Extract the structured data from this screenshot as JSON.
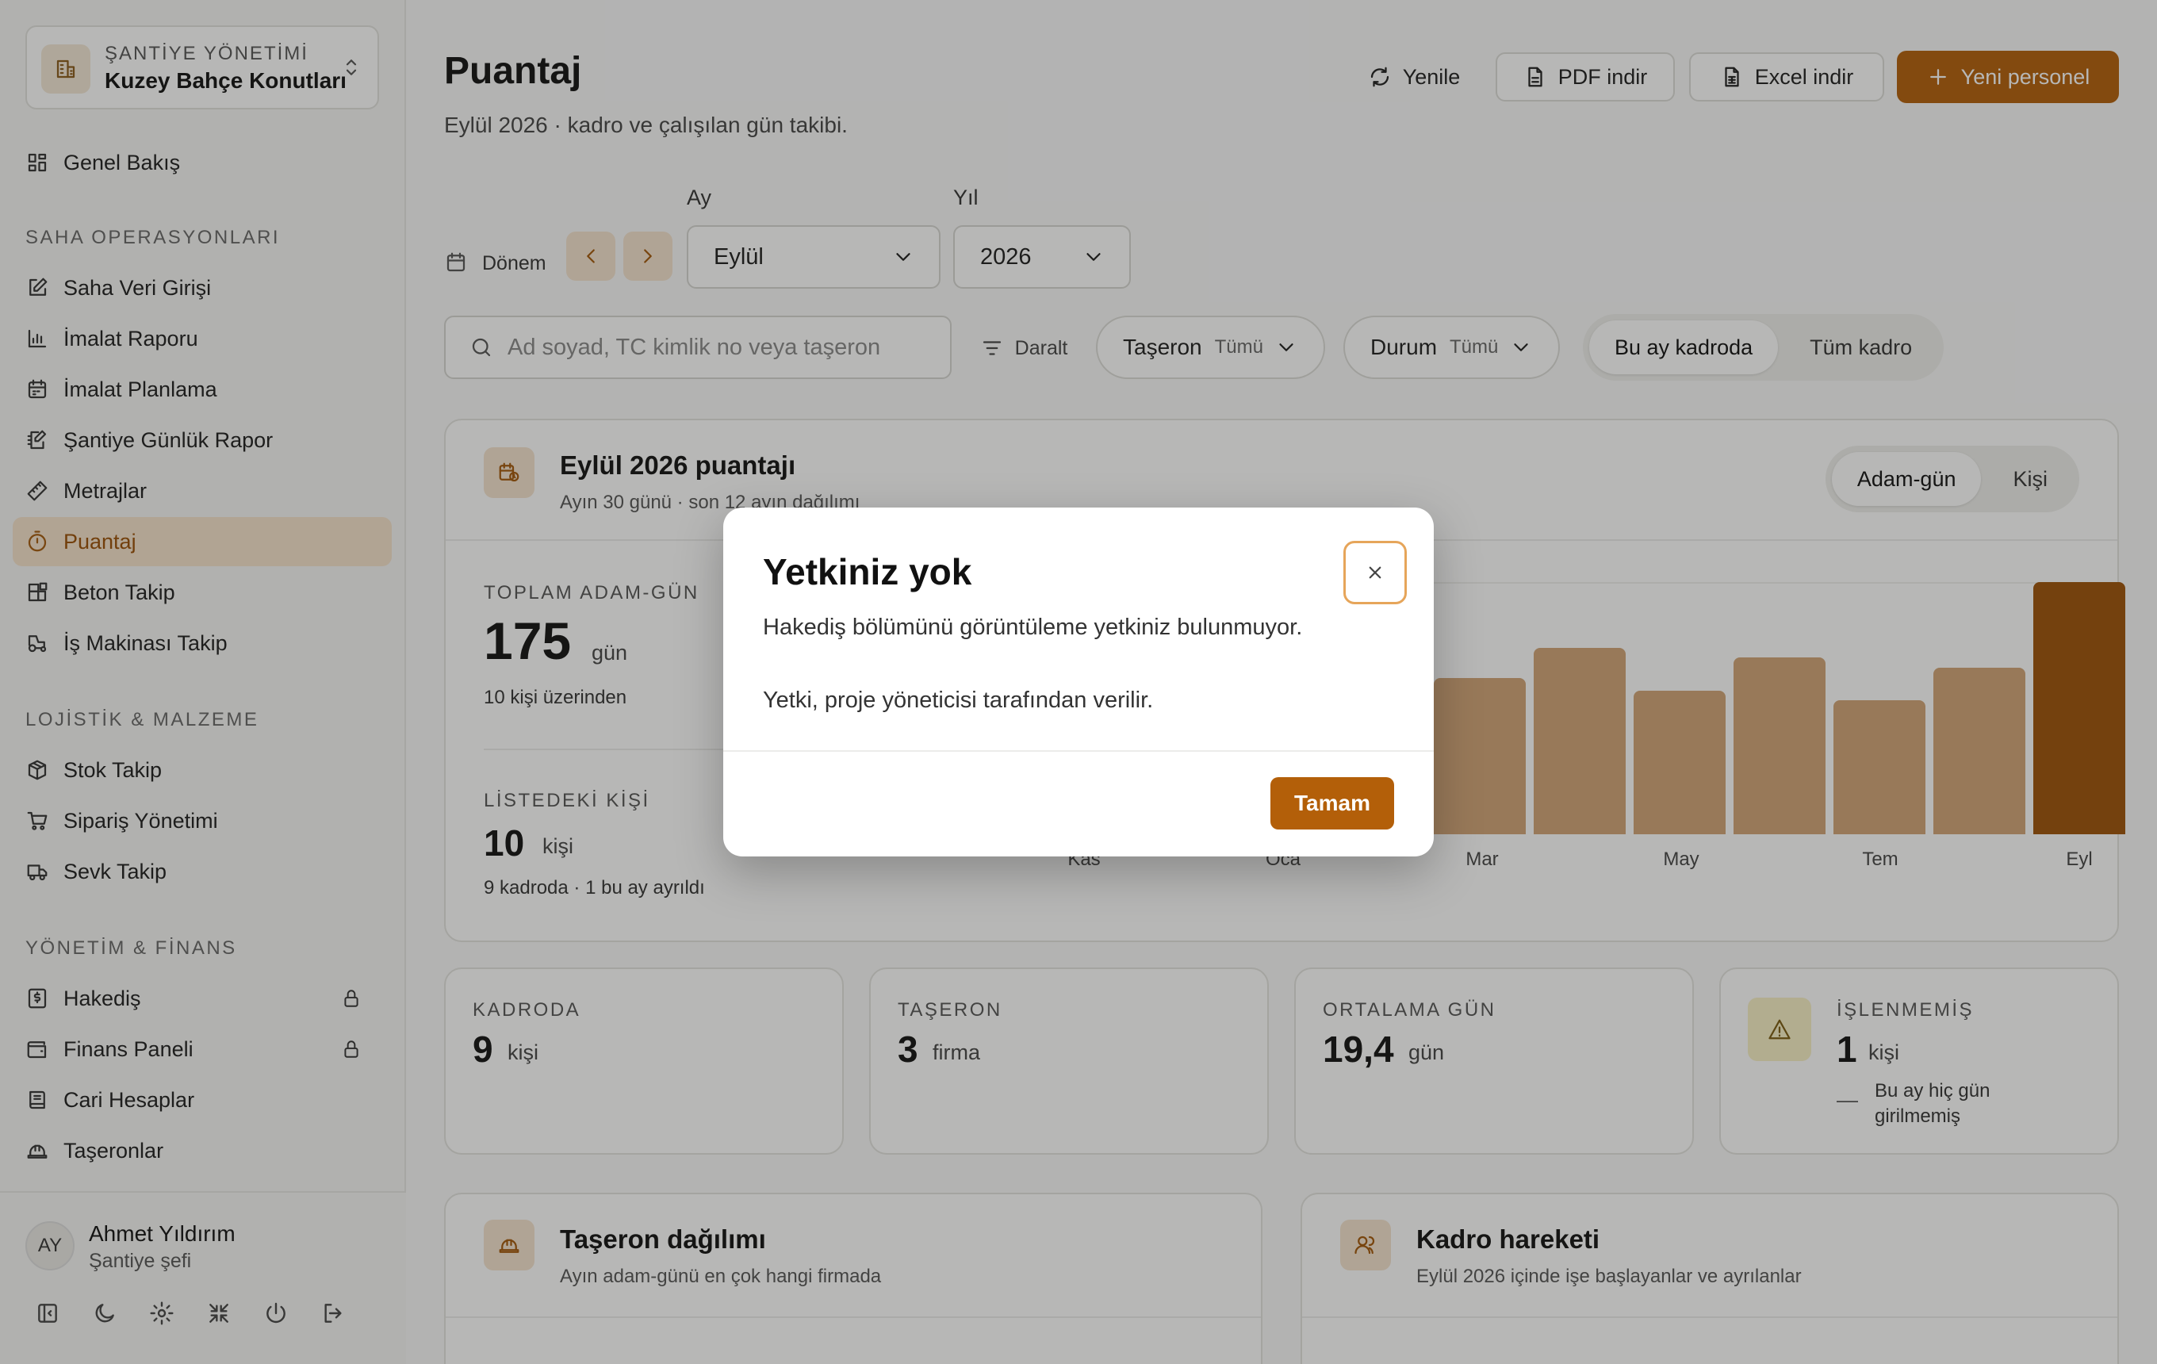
{
  "sidebar": {
    "project_kicker": "ŞANTİYE YÖNETİMİ",
    "project_name": "Kuzey Bahçe Konutları",
    "overview": "Genel Bakış",
    "sections": {
      "ops": "SAHA OPERASYONLARI",
      "logistics": "LOJİSTİK & MALZEME",
      "mgmt": "YÖNETİM & FİNANS"
    },
    "ops_items": [
      "Saha Veri Girişi",
      "İmalat Raporu",
      "İmalat Planlama",
      "Şantiye Günlük Rapor",
      "Metrajlar",
      "Puantaj",
      "Beton Takip",
      "İş Makinası Takip"
    ],
    "logistics_items": [
      "Stok Takip",
      "Sipariş Yönetimi",
      "Sevk Takip"
    ],
    "mgmt_items": [
      "Hakediş",
      "Finans Paneli",
      "Cari Hesaplar",
      "Taşeronlar"
    ],
    "active_item": "Puantaj",
    "locked_items": [
      "Hakediş",
      "Finans Paneli"
    ],
    "user": {
      "initials": "AY",
      "name": "Ahmet Yıldırım",
      "role": "Şantiye şefi"
    }
  },
  "header": {
    "title": "Puantaj",
    "subtitle": "Eylül 2026 · kadro ve çalışılan gün takibi.",
    "refresh": "Yenile",
    "pdf": "PDF indir",
    "excel": "Excel indir",
    "new_staff": "Yeni personel"
  },
  "filters": {
    "period_label": "Dönem",
    "month_label": "Ay",
    "month_value": "Eylül",
    "year_label": "Yıl",
    "year_value": "2026",
    "search_placeholder": "Ad soyad, TC kimlik no veya taşeron",
    "narrow": "Daralt",
    "subcontractor_label": "Taşeron",
    "subcontractor_value": "Tümü",
    "status_label": "Durum",
    "status_value": "Tümü",
    "scope_options": [
      "Bu ay kadroda",
      "Tüm kadro"
    ],
    "scope_selected": "Bu ay kadroda"
  },
  "summary_card": {
    "title": "Eylül 2026 puantajı",
    "subtitle": "Ayın 30 günü · son 12 ayın dağılımı",
    "toggle_options": [
      "Adam-gün",
      "Kişi"
    ],
    "toggle_selected": "Adam-gün",
    "total_label": "TOPLAM ADAM-GÜN",
    "total_value": "175",
    "total_unit": "gün",
    "total_note": "10 kişi üzerinden",
    "list_label": "LİSTEDEKİ KİŞİ",
    "list_value": "10",
    "list_unit": "kişi",
    "list_note": "9 kadroda · 1 bu ay ayrıldı"
  },
  "chart_data": {
    "type": "bar",
    "visible_categories": [
      "Kas",
      "Oca",
      "Mar",
      "May",
      "Tem",
      "Eyl"
    ],
    "visible_bar_values_relative": [
      0.62,
      0.74,
      0.57,
      0.7,
      0.53,
      0.66,
      1.0
    ],
    "highlighted": "Eyl"
  },
  "stats": [
    {
      "label": "KADRODA",
      "value": "9",
      "unit": "kişi"
    },
    {
      "label": "TAŞERON",
      "value": "3",
      "unit": "firma"
    },
    {
      "label": "ORTALAMA GÜN",
      "value": "19,4",
      "unit": "gün"
    },
    {
      "label": "İŞLENMEMİŞ",
      "value": "1",
      "unit": "kişi",
      "note_dash": "—",
      "note": "Bu ay hiç gün girilmemiş"
    }
  ],
  "subcontractor_card": {
    "title": "Taşeron dağılımı",
    "subtitle": "Ayın adam-günü en çok hangi firmada"
  },
  "movement_card": {
    "title": "Kadro hareketi",
    "subtitle": "Eylül 2026 içinde işe başlayanlar ve ayrılanlar"
  },
  "modal": {
    "title": "Yetkiniz yok",
    "body": "Hakediş bölümünü görüntüleme yetkiniz bulunmuyor.\n\nYetki, proje yöneticisi tarafından verilir.",
    "ok": "Tamam"
  },
  "colors": {
    "accent": "#b35f09",
    "accent_soft": "#f5e4cf",
    "bar": "#d1a477",
    "bar_current": "#9d5208"
  }
}
